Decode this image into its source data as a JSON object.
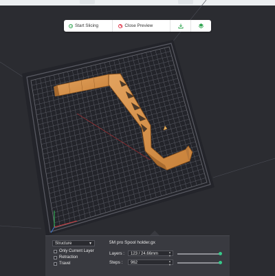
{
  "toolbar": {
    "start_slicing": "Start Slicing",
    "close_preview": "Close Preview",
    "download_icon": "download-icon",
    "print_icon": "print-icon",
    "accent_green": "#2ea44f",
    "accent_red": "#e0364a"
  },
  "panel": {
    "view_mode": "Structure",
    "checkboxes": [
      {
        "label": "Only Current Layer",
        "checked": false
      },
      {
        "label": "Retraction",
        "checked": false
      },
      {
        "label": "Travel",
        "checked": false
      }
    ],
    "file_name": "5M pro Spool holder.gx",
    "layers_label": "Layers :",
    "layers_value": "123 / 24.66mm",
    "steps_label": "Steps :",
    "steps_value": "962",
    "layers_slider_fraction": 1.0,
    "steps_slider_fraction": 1.0,
    "slider_color": "#37c98a"
  }
}
